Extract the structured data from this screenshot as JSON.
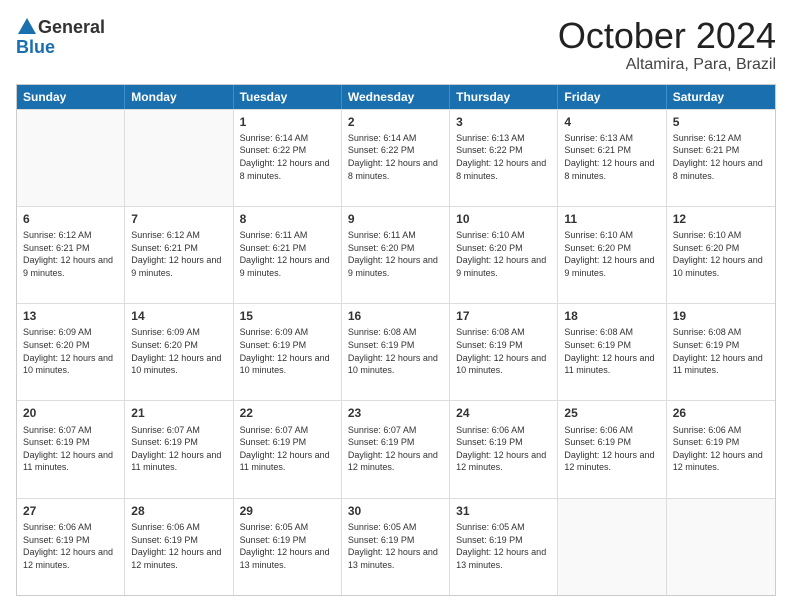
{
  "header": {
    "logo_general": "General",
    "logo_blue": "Blue",
    "month": "October 2024",
    "location": "Altamira, Para, Brazil"
  },
  "weekdays": [
    "Sunday",
    "Monday",
    "Tuesday",
    "Wednesday",
    "Thursday",
    "Friday",
    "Saturday"
  ],
  "rows": [
    [
      {
        "day": "",
        "sunrise": "",
        "sunset": "",
        "daylight": ""
      },
      {
        "day": "",
        "sunrise": "",
        "sunset": "",
        "daylight": ""
      },
      {
        "day": "1",
        "sunrise": "Sunrise: 6:14 AM",
        "sunset": "Sunset: 6:22 PM",
        "daylight": "Daylight: 12 hours and 8 minutes."
      },
      {
        "day": "2",
        "sunrise": "Sunrise: 6:14 AM",
        "sunset": "Sunset: 6:22 PM",
        "daylight": "Daylight: 12 hours and 8 minutes."
      },
      {
        "day": "3",
        "sunrise": "Sunrise: 6:13 AM",
        "sunset": "Sunset: 6:22 PM",
        "daylight": "Daylight: 12 hours and 8 minutes."
      },
      {
        "day": "4",
        "sunrise": "Sunrise: 6:13 AM",
        "sunset": "Sunset: 6:21 PM",
        "daylight": "Daylight: 12 hours and 8 minutes."
      },
      {
        "day": "5",
        "sunrise": "Sunrise: 6:12 AM",
        "sunset": "Sunset: 6:21 PM",
        "daylight": "Daylight: 12 hours and 8 minutes."
      }
    ],
    [
      {
        "day": "6",
        "sunrise": "Sunrise: 6:12 AM",
        "sunset": "Sunset: 6:21 PM",
        "daylight": "Daylight: 12 hours and 9 minutes."
      },
      {
        "day": "7",
        "sunrise": "Sunrise: 6:12 AM",
        "sunset": "Sunset: 6:21 PM",
        "daylight": "Daylight: 12 hours and 9 minutes."
      },
      {
        "day": "8",
        "sunrise": "Sunrise: 6:11 AM",
        "sunset": "Sunset: 6:21 PM",
        "daylight": "Daylight: 12 hours and 9 minutes."
      },
      {
        "day": "9",
        "sunrise": "Sunrise: 6:11 AM",
        "sunset": "Sunset: 6:20 PM",
        "daylight": "Daylight: 12 hours and 9 minutes."
      },
      {
        "day": "10",
        "sunrise": "Sunrise: 6:10 AM",
        "sunset": "Sunset: 6:20 PM",
        "daylight": "Daylight: 12 hours and 9 minutes."
      },
      {
        "day": "11",
        "sunrise": "Sunrise: 6:10 AM",
        "sunset": "Sunset: 6:20 PM",
        "daylight": "Daylight: 12 hours and 9 minutes."
      },
      {
        "day": "12",
        "sunrise": "Sunrise: 6:10 AM",
        "sunset": "Sunset: 6:20 PM",
        "daylight": "Daylight: 12 hours and 10 minutes."
      }
    ],
    [
      {
        "day": "13",
        "sunrise": "Sunrise: 6:09 AM",
        "sunset": "Sunset: 6:20 PM",
        "daylight": "Daylight: 12 hours and 10 minutes."
      },
      {
        "day": "14",
        "sunrise": "Sunrise: 6:09 AM",
        "sunset": "Sunset: 6:20 PM",
        "daylight": "Daylight: 12 hours and 10 minutes."
      },
      {
        "day": "15",
        "sunrise": "Sunrise: 6:09 AM",
        "sunset": "Sunset: 6:19 PM",
        "daylight": "Daylight: 12 hours and 10 minutes."
      },
      {
        "day": "16",
        "sunrise": "Sunrise: 6:08 AM",
        "sunset": "Sunset: 6:19 PM",
        "daylight": "Daylight: 12 hours and 10 minutes."
      },
      {
        "day": "17",
        "sunrise": "Sunrise: 6:08 AM",
        "sunset": "Sunset: 6:19 PM",
        "daylight": "Daylight: 12 hours and 10 minutes."
      },
      {
        "day": "18",
        "sunrise": "Sunrise: 6:08 AM",
        "sunset": "Sunset: 6:19 PM",
        "daylight": "Daylight: 12 hours and 11 minutes."
      },
      {
        "day": "19",
        "sunrise": "Sunrise: 6:08 AM",
        "sunset": "Sunset: 6:19 PM",
        "daylight": "Daylight: 12 hours and 11 minutes."
      }
    ],
    [
      {
        "day": "20",
        "sunrise": "Sunrise: 6:07 AM",
        "sunset": "Sunset: 6:19 PM",
        "daylight": "Daylight: 12 hours and 11 minutes."
      },
      {
        "day": "21",
        "sunrise": "Sunrise: 6:07 AM",
        "sunset": "Sunset: 6:19 PM",
        "daylight": "Daylight: 12 hours and 11 minutes."
      },
      {
        "day": "22",
        "sunrise": "Sunrise: 6:07 AM",
        "sunset": "Sunset: 6:19 PM",
        "daylight": "Daylight: 12 hours and 11 minutes."
      },
      {
        "day": "23",
        "sunrise": "Sunrise: 6:07 AM",
        "sunset": "Sunset: 6:19 PM",
        "daylight": "Daylight: 12 hours and 12 minutes."
      },
      {
        "day": "24",
        "sunrise": "Sunrise: 6:06 AM",
        "sunset": "Sunset: 6:19 PM",
        "daylight": "Daylight: 12 hours and 12 minutes."
      },
      {
        "day": "25",
        "sunrise": "Sunrise: 6:06 AM",
        "sunset": "Sunset: 6:19 PM",
        "daylight": "Daylight: 12 hours and 12 minutes."
      },
      {
        "day": "26",
        "sunrise": "Sunrise: 6:06 AM",
        "sunset": "Sunset: 6:19 PM",
        "daylight": "Daylight: 12 hours and 12 minutes."
      }
    ],
    [
      {
        "day": "27",
        "sunrise": "Sunrise: 6:06 AM",
        "sunset": "Sunset: 6:19 PM",
        "daylight": "Daylight: 12 hours and 12 minutes."
      },
      {
        "day": "28",
        "sunrise": "Sunrise: 6:06 AM",
        "sunset": "Sunset: 6:19 PM",
        "daylight": "Daylight: 12 hours and 12 minutes."
      },
      {
        "day": "29",
        "sunrise": "Sunrise: 6:05 AM",
        "sunset": "Sunset: 6:19 PM",
        "daylight": "Daylight: 12 hours and 13 minutes."
      },
      {
        "day": "30",
        "sunrise": "Sunrise: 6:05 AM",
        "sunset": "Sunset: 6:19 PM",
        "daylight": "Daylight: 12 hours and 13 minutes."
      },
      {
        "day": "31",
        "sunrise": "Sunrise: 6:05 AM",
        "sunset": "Sunset: 6:19 PM",
        "daylight": "Daylight: 12 hours and 13 minutes."
      },
      {
        "day": "",
        "sunrise": "",
        "sunset": "",
        "daylight": ""
      },
      {
        "day": "",
        "sunrise": "",
        "sunset": "",
        "daylight": ""
      }
    ]
  ]
}
